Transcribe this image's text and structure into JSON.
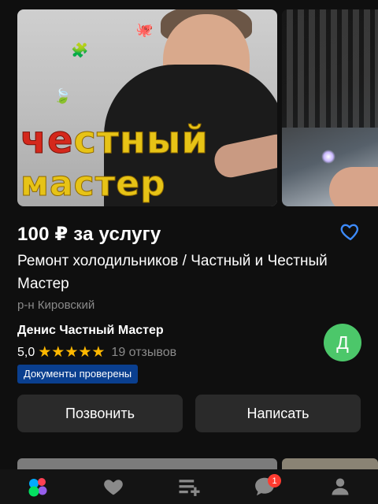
{
  "gallery": {
    "overlay_line1_red": "че",
    "overlay_line1_rest": "стный",
    "overlay_line2": "мастер"
  },
  "listing": {
    "price": "100 ₽ за услугу",
    "title": "Ремонт холодильников / Частный и Честный Мастер",
    "district": "р-н Кировский"
  },
  "seller": {
    "name": "Денис Частный Мастер",
    "rating": "5,0",
    "stars": "★★★★★",
    "reviews": "19 отзывов",
    "avatar_letter": "Д",
    "badge": "Документы проверены"
  },
  "actions": {
    "call": "Позвонить",
    "write": "Написать"
  },
  "tabbar": {
    "messages_count": "1",
    "icons": [
      "home-icon",
      "favorites-icon",
      "add-listing-icon",
      "messages-icon",
      "profile-icon"
    ]
  },
  "colors": {
    "background": "#0f0f0f",
    "star": "#ffb800",
    "avatar": "#4cc76a",
    "badge": "#0a3f8f",
    "heart_outline": "#3d8bfd"
  }
}
